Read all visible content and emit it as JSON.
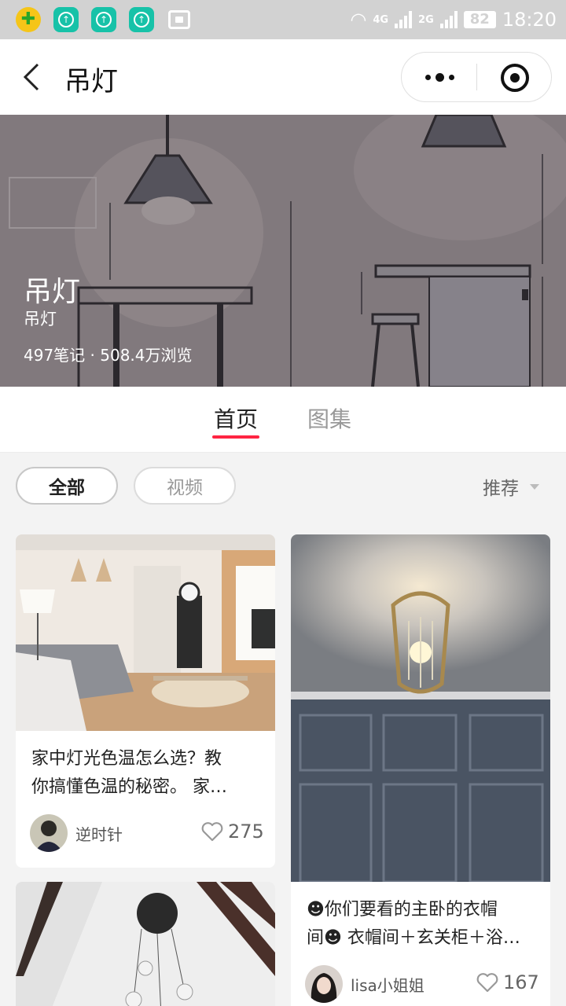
{
  "status_bar": {
    "net1": "4G",
    "net2": "2G",
    "battery": "82",
    "time": "18:20"
  },
  "nav": {
    "title": "吊灯"
  },
  "banner": {
    "title": "吊灯",
    "subtitle": "吊灯",
    "stats": "497笔记 · 508.4万浏览"
  },
  "tabs": [
    {
      "label": "首页",
      "active": true
    },
    {
      "label": "图集",
      "active": false
    }
  ],
  "filters": {
    "all": "全部",
    "video": "视频",
    "sort": "推荐"
  },
  "cards": [
    {
      "title_line1": "家中灯光色温怎么选？教",
      "title_line2": "你搞懂色温的秘密。 家…",
      "author": "逆时针",
      "likes": "275"
    },
    {
      "title_line1": "☻你们要看的主卧的衣帽",
      "title_line2": "间☻ 衣帽间＋玄关柜＋浴…",
      "author": "lisa小姐姐",
      "likes": "167"
    }
  ],
  "colors": {
    "accent": "#ff2442",
    "status_bar": "#d2d2d2",
    "app_icon": "#17c2a8"
  }
}
